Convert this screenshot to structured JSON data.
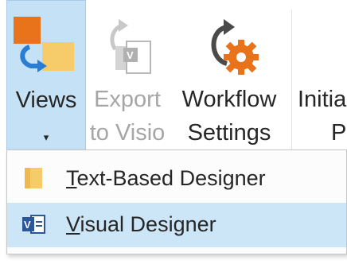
{
  "ribbon": {
    "views": {
      "label": "Views",
      "caret": "▾"
    },
    "export_to_visio": {
      "line1": "Export",
      "line2": "to Visio"
    },
    "workflow_settings": {
      "line1": "Workflow",
      "line2": "Settings"
    },
    "initiation": {
      "line1": "Initia",
      "line2": "Pa"
    }
  },
  "views_menu": {
    "items": [
      {
        "accel": "T",
        "rest": "ext-Based Designer",
        "icon": "text-designer-icon"
      },
      {
        "accel": "V",
        "rest": "isual Designer",
        "icon": "visio-icon",
        "highlighted": true
      }
    ]
  },
  "colors": {
    "selected_bg": "#c5e1f6",
    "hover_item_bg": "#cde6f7",
    "disabled_text": "#a6a6a6",
    "visio_blue": "#2b579a",
    "orange": "#e67e22"
  }
}
